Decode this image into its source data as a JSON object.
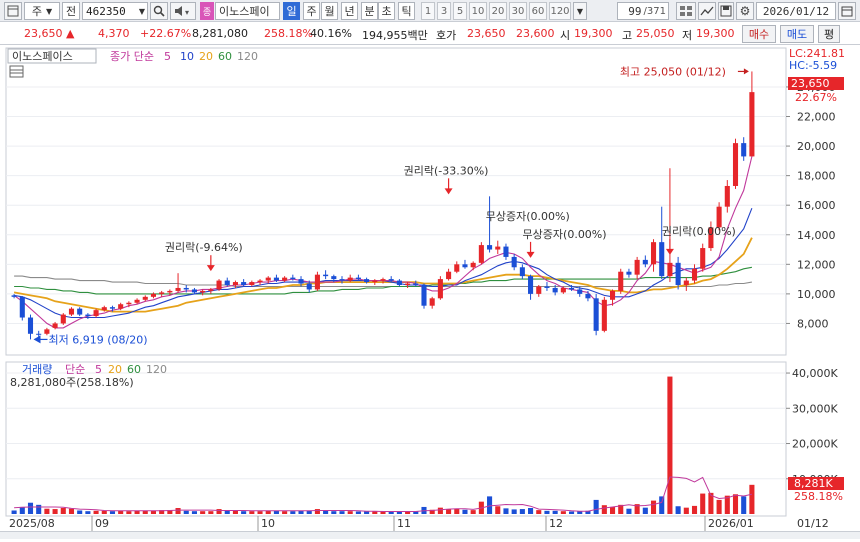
{
  "toolbar": {
    "mode": "주",
    "market": "전",
    "code": "462350",
    "code_badge": "종",
    "name": "이노스페이",
    "periods": [
      "일",
      "주",
      "월",
      "년",
      "분",
      "초",
      "틱"
    ],
    "active_period": "일",
    "per_values": [
      "1",
      "3",
      "5",
      "10",
      "20",
      "30",
      "60",
      "120"
    ],
    "count": "99",
    "count_total": "/371",
    "date": "2026/01/12"
  },
  "quote": {
    "price": "23,650",
    "change": "4,370",
    "change_pct": "+22.67%",
    "volume": "8,281,080",
    "vol_ratio": "258.18%",
    "turnover": "40.16%",
    "amount": "194,955백만",
    "ask_label": "호가",
    "ask": "23,650",
    "bid": "23,600",
    "open_label": "시",
    "open": "19,300",
    "high_label": "고",
    "high": "25,050",
    "low_label": "저",
    "low": "19,300",
    "buy_label": "매수",
    "sell_label": "매도",
    "eval_label": "평"
  },
  "price_panel": {
    "stock_name": "이노스페이스",
    "ma_label": "종가 단순",
    "ma_periods": [
      "5",
      "10",
      "20",
      "60",
      "120"
    ],
    "lc": "LC:241.81",
    "hc": "HC:-5.59",
    "price_tag": "23,650",
    "pct_tag": "22.67%",
    "high_note": "최고 25,050 (01/12)",
    "low_note": "최저 6,919 (08/20)",
    "events": [
      "권리락(-9.64%)",
      "권리락(-33.30%)",
      "무상증자(0.00%)",
      "무상증자(0.00%)",
      "권리락(0.00%)"
    ]
  },
  "volume_panel": {
    "label": "거래량",
    "ma_label": "단순",
    "ma_periods": [
      "5",
      "20",
      "60",
      "120"
    ],
    "value_text": "8,281,080주(258.18%)",
    "tag_value": "8,281K",
    "tag_pct": "258.18%"
  },
  "colors": {
    "up": "#e6262a",
    "down": "#1b4fd6",
    "ma5": "#c0389b",
    "ma10": "#2243c9",
    "ma20": "#e6a21a",
    "ma60": "#2f8f3e",
    "ma120": "#8a8a8a"
  },
  "chart_data": {
    "type": "candlestick",
    "y_ticks": [
      8000,
      10000,
      12000,
      14000,
      16000,
      18000,
      20000,
      22000,
      24000
    ],
    "ylim": [
      6000,
      26500
    ],
    "vol_ticks": [
      "10,000K",
      "20,000K",
      "30,000K",
      "40,000K"
    ],
    "vol_ylim": [
      0,
      42000
    ],
    "x_labels": [
      "2025/08",
      "09",
      "10",
      "11",
      "12",
      "2026/01",
      "01/12"
    ],
    "candles": [
      [
        9900,
        9990,
        9700,
        9800,
        1000
      ],
      [
        9800,
        9850,
        8200,
        8400,
        2000
      ],
      [
        8400,
        8600,
        6919,
        7300,
        3200
      ],
      [
        7300,
        7500,
        7050,
        7250,
        2600
      ],
      [
        7300,
        7700,
        7200,
        7600,
        1500
      ],
      [
        7700,
        8100,
        7600,
        8000,
        1400
      ],
      [
        8000,
        8700,
        7900,
        8600,
        1700
      ],
      [
        8600,
        9100,
        8500,
        9000,
        1500
      ],
      [
        9000,
        9100,
        8500,
        8600,
        1000
      ],
      [
        8600,
        8700,
        8300,
        8500,
        800
      ],
      [
        8500,
        9000,
        8400,
        8900,
        900
      ],
      [
        8900,
        9200,
        8800,
        9100,
        900
      ],
      [
        9100,
        9200,
        8800,
        9000,
        800
      ],
      [
        9000,
        9400,
        8900,
        9300,
        900
      ],
      [
        9300,
        9500,
        9100,
        9400,
        800
      ],
      [
        9400,
        9700,
        9300,
        9600,
        900
      ],
      [
        9600,
        9900,
        9500,
        9800,
        1000
      ],
      [
        9800,
        10100,
        9700,
        10000,
        1000
      ],
      [
        10000,
        10200,
        9800,
        10100,
        1100
      ],
      [
        10100,
        10300,
        9900,
        10200,
        1100
      ],
      [
        10200,
        11400,
        10100,
        10400,
        1700
      ],
      [
        10400,
        10600,
        10100,
        10300,
        900
      ],
      [
        10300,
        10400,
        10000,
        10100,
        800
      ],
      [
        10100,
        10300,
        9900,
        10200,
        800
      ],
      [
        10200,
        10400,
        10000,
        10300,
        800
      ],
      [
        10300,
        11000,
        10200,
        10900,
        1400
      ],
      [
        10900,
        11100,
        10500,
        10600,
        1000
      ],
      [
        10600,
        10900,
        10400,
        10800,
        900
      ],
      [
        10800,
        11000,
        10500,
        10600,
        800
      ],
      [
        10600,
        10900,
        10500,
        10800,
        800
      ],
      [
        10800,
        11000,
        10600,
        10900,
        800
      ],
      [
        10900,
        11200,
        10700,
        11100,
        1000
      ],
      [
        11100,
        11300,
        10800,
        10900,
        900
      ],
      [
        10900,
        11200,
        10800,
        11100,
        800
      ],
      [
        11100,
        11300,
        10900,
        11000,
        800
      ],
      [
        11000,
        11200,
        10500,
        10700,
        900
      ],
      [
        10700,
        10900,
        10100,
        10300,
        1000
      ],
      [
        10300,
        11500,
        10200,
        11300,
        1400
      ],
      [
        11300,
        11600,
        11000,
        11200,
        1000
      ],
      [
        11200,
        11300,
        10800,
        11000,
        800
      ],
      [
        11000,
        11200,
        10700,
        10900,
        800
      ],
      [
        10900,
        11300,
        10800,
        11100,
        800
      ],
      [
        11100,
        11300,
        10900,
        11000,
        700
      ],
      [
        11000,
        11100,
        10700,
        10800,
        700
      ],
      [
        10800,
        11000,
        10600,
        10900,
        700
      ],
      [
        10900,
        11100,
        10700,
        11000,
        700
      ],
      [
        11000,
        11200,
        10800,
        10900,
        700
      ],
      [
        10900,
        11000,
        10500,
        10600,
        700
      ],
      [
        10600,
        10800,
        10400,
        10700,
        700
      ],
      [
        10700,
        10900,
        10500,
        10600,
        700
      ],
      [
        10600,
        10700,
        9000,
        9200,
        2000
      ],
      [
        9200,
        9800,
        9000,
        9700,
        1200
      ],
      [
        9700,
        11200,
        9600,
        11000,
        1800
      ],
      [
        11000,
        11700,
        10900,
        11500,
        1400
      ],
      [
        11500,
        12200,
        11400,
        12000,
        1500
      ],
      [
        12000,
        12300,
        11700,
        11800,
        1200
      ],
      [
        11800,
        12200,
        11600,
        12100,
        1100
      ],
      [
        12100,
        13500,
        12000,
        13300,
        3500
      ],
      [
        13300,
        16600,
        12800,
        13000,
        5000
      ],
      [
        13000,
        13600,
        12700,
        13200,
        2200
      ],
      [
        13200,
        13400,
        12300,
        12500,
        1600
      ],
      [
        12500,
        12700,
        11600,
        11800,
        1300
      ],
      [
        11800,
        12000,
        11000,
        11200,
        1400
      ],
      [
        11200,
        11300,
        9600,
        10000,
        1700
      ],
      [
        10000,
        10600,
        9800,
        10500,
        1100
      ],
      [
        10500,
        10800,
        10200,
        10400,
        900
      ],
      [
        10400,
        10600,
        9900,
        10100,
        900
      ],
      [
        10100,
        10500,
        10000,
        10400,
        800
      ],
      [
        10400,
        10600,
        10200,
        10300,
        700
      ],
      [
        10300,
        10500,
        9800,
        10000,
        800
      ],
      [
        10000,
        10200,
        9500,
        9700,
        900
      ],
      [
        9700,
        10000,
        7200,
        7500,
        4000
      ],
      [
        7500,
        9800,
        7400,
        9600,
        2500
      ],
      [
        9600,
        10300,
        9200,
        10200,
        2000
      ],
      [
        10200,
        11700,
        10000,
        11500,
        2600
      ],
      [
        11500,
        11700,
        11100,
        11300,
        1500
      ],
      [
        11300,
        12500,
        11000,
        12300,
        2800
      ],
      [
        12300,
        12600,
        11800,
        12000,
        1800
      ],
      [
        12000,
        13700,
        11500,
        13500,
        3800
      ],
      [
        13500,
        15900,
        11000,
        11200,
        5000
      ],
      [
        11200,
        18500,
        10800,
        12100,
        39000
      ],
      [
        12100,
        12500,
        10300,
        10600,
        2200
      ],
      [
        10600,
        11100,
        10200,
        10900,
        1800
      ],
      [
        10900,
        12000,
        10700,
        11700,
        2300
      ],
      [
        11700,
        13400,
        11500,
        13100,
        5800
      ],
      [
        13100,
        14900,
        12900,
        14500,
        6000
      ],
      [
        14500,
        16200,
        14300,
        15900,
        4000
      ],
      [
        15900,
        17700,
        15500,
        17300,
        5200
      ],
      [
        17300,
        20500,
        17100,
        20200,
        5600
      ],
      [
        20200,
        20600,
        19000,
        19300,
        5000
      ],
      [
        19300,
        25050,
        19300,
        23650,
        8281
      ]
    ],
    "series": [
      {
        "name": "5",
        "values": [
          9900,
          9500,
          9000,
          8500,
          8000,
          7700,
          7700,
          8000,
          8300,
          8500,
          8600,
          8700,
          8900,
          9000,
          9200,
          9300,
          9500,
          9600,
          9800,
          9900,
          10100,
          10200,
          10200,
          10300,
          10300,
          10400,
          10500,
          10600,
          10600,
          10700,
          10800,
          10800,
          10900,
          10900,
          11000,
          10900,
          10800,
          10800,
          10800,
          10800,
          10900,
          11000,
          11000,
          10900,
          10900,
          10900,
          10900,
          10800,
          10800,
          10700,
          10400,
          10200,
          10200,
          10400,
          10700,
          11200,
          11700,
          12000,
          12400,
          12600,
          12800,
          12700,
          12400,
          11800,
          11300,
          10900,
          10700,
          10400,
          10300,
          10200,
          10100,
          9500,
          9200,
          9300,
          9600,
          10100,
          10900,
          11400,
          12200,
          12100,
          12000,
          11800,
          11600,
          11400,
          11600,
          11800,
          12500,
          14400,
          15800,
          17000,
          19300
        ]
      },
      {
        "name": "10",
        "values": [
          9900,
          9800,
          9600,
          9300,
          9000,
          8700,
          8500,
          8400,
          8400,
          8400,
          8400,
          8400,
          8500,
          8600,
          8700,
          8900,
          9100,
          9200,
          9400,
          9600,
          9800,
          9900,
          10000,
          10100,
          10200,
          10300,
          10300,
          10400,
          10500,
          10500,
          10600,
          10700,
          10700,
          10800,
          10800,
          10800,
          10800,
          10800,
          10900,
          10900,
          10900,
          10900,
          10900,
          10900,
          10900,
          10900,
          10800,
          10700,
          10600,
          10600,
          10600,
          10500,
          10500,
          10600,
          10600,
          10900,
          11100,
          11300,
          11600,
          11900,
          12100,
          12200,
          12100,
          11900,
          11700,
          11300,
          11000,
          10800,
          10500,
          10400,
          10300,
          10100,
          9900,
          9800,
          9800,
          9800,
          10000,
          10200,
          10600,
          10900,
          11300,
          11500,
          11700,
          11700,
          11800,
          12000,
          12400,
          13000,
          13700,
          14400,
          15800
        ]
      },
      {
        "name": "20",
        "values": [
          10100,
          10000,
          9900,
          9800,
          9700,
          9500,
          9400,
          9300,
          9200,
          9100,
          9000,
          8900,
          8800,
          8800,
          8800,
          8800,
          8800,
          8900,
          9000,
          9100,
          9200,
          9400,
          9500,
          9600,
          9700,
          9800,
          9900,
          10000,
          10100,
          10200,
          10300,
          10400,
          10400,
          10500,
          10600,
          10600,
          10700,
          10700,
          10800,
          10800,
          10800,
          10800,
          10800,
          10800,
          10800,
          10800,
          10800,
          10800,
          10800,
          10800,
          10700,
          10700,
          10700,
          10700,
          10700,
          10800,
          10900,
          11000,
          11100,
          11200,
          11300,
          11300,
          11300,
          11200,
          11200,
          11100,
          11000,
          10900,
          10800,
          10700,
          10600,
          10400,
          10300,
          10200,
          10200,
          10100,
          10100,
          10200,
          10300,
          10300,
          10400,
          10500,
          10600,
          10700,
          10900,
          11000,
          11300,
          11700,
          12200,
          12700,
          13800
        ]
      },
      {
        "name": "60",
        "values": [
          10500,
          10500,
          10400,
          10400,
          10300,
          10300,
          10200,
          10200,
          10100,
          10100,
          10000,
          10000,
          10000,
          10000,
          10000,
          10000,
          10000,
          10000,
          10000,
          10000,
          10000,
          10000,
          10000,
          10000,
          10000,
          10000,
          10000,
          10000,
          10000,
          10000,
          10000,
          10000,
          10000,
          10000,
          10100,
          10100,
          10100,
          10200,
          10200,
          10200,
          10300,
          10300,
          10300,
          10400,
          10400,
          10400,
          10500,
          10500,
          10500,
          10500,
          10500,
          10600,
          10600,
          10600,
          10700,
          10700,
          10800,
          10800,
          10900,
          10900,
          10900,
          11000,
          11000,
          11000,
          11000,
          11000,
          11000,
          11000,
          11000,
          11000,
          11000,
          11000,
          11000,
          11000,
          11000,
          11000,
          11000,
          11100,
          11100,
          11100,
          11100,
          11100,
          11100,
          11100,
          11200,
          11200,
          11300,
          11400,
          11500,
          11700,
          11800
        ]
      },
      {
        "name": "120",
        "values": [
          11200,
          11200,
          11100,
          11100,
          11100,
          11000,
          11000,
          11000,
          10900,
          10900,
          10900,
          10900,
          10800,
          10800,
          10800,
          10800,
          10700,
          10700,
          10700,
          10700,
          10700,
          10600,
          10600,
          10600,
          10600,
          10600,
          10600,
          10500,
          10500,
          10500,
          10500,
          10500,
          10500,
          10500,
          10500,
          10500,
          10500,
          10500,
          10500,
          10500,
          10500,
          10500,
          10500,
          10500,
          10500,
          10500,
          10500,
          10500,
          10500,
          10500,
          10500,
          10500,
          10500,
          10500,
          10500,
          10500,
          10500,
          10500,
          10500,
          10500,
          10500,
          10500,
          10500,
          10500,
          10500,
          10500,
          10500,
          10500,
          10500,
          10500,
          10500,
          10500,
          10500,
          10500,
          10500,
          10500,
          10500,
          10500,
          10500,
          10500,
          10500,
          10500,
          10500,
          10500,
          10500,
          10500,
          10600,
          10600,
          10700,
          10700,
          10800
        ]
      }
    ],
    "vol_ma5": [
      1800,
      1900,
      2000,
      2000,
      2000,
      2000,
      1900,
      1600,
      1400,
      1300,
      1200,
      1000,
      900,
      900,
      900,
      900,
      900,
      900,
      900,
      1000,
      1100,
      1100,
      1100,
      1100,
      1100,
      1000,
      1000,
      1000,
      1000,
      900,
      900,
      900,
      900,
      900,
      900,
      900,
      900,
      1000,
      1000,
      1000,
      1000,
      1000,
      900,
      800,
      800,
      700,
      700,
      700,
      700,
      700,
      900,
      1000,
      1200,
      1400,
      1500,
      1500,
      1300,
      1700,
      2300,
      2500,
      2700,
      2600,
      2700,
      2200,
      1400,
      1300,
      1200,
      1100,
      900,
      800,
      800,
      1300,
      1700,
      2000,
      2300,
      2600,
      2300,
      2400,
      2700,
      3300,
      10500,
      10400,
      10100,
      9100,
      10400,
      5300,
      4400,
      4600,
      5300,
      5100,
      5600
    ]
  }
}
